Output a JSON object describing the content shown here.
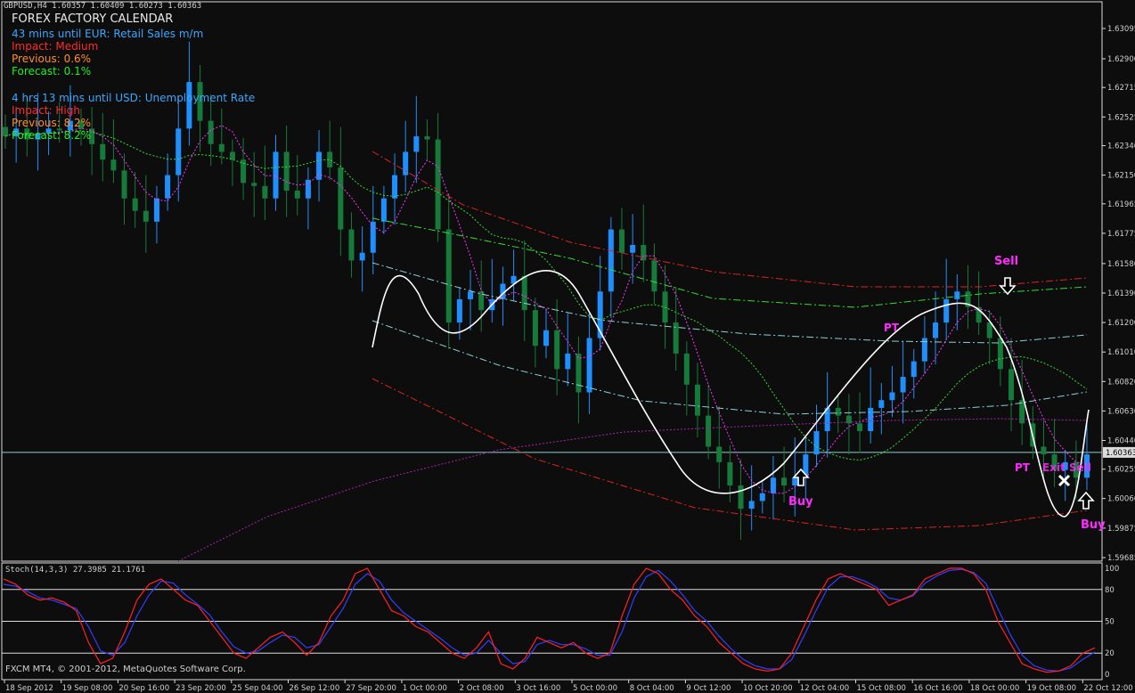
{
  "header": {
    "symbol_line": "GBPUSD,H4  1.60357 1.60409 1.60273 1.60363"
  },
  "calendar": {
    "title": "FOREX FACTORY CALENDAR",
    "event1": {
      "countdown": "43 mins until EUR: Retail Sales m/m",
      "impact": "Impact: Medium",
      "previous": "Previous: 0.6%",
      "forecast": "Forecast: 0.1%"
    },
    "event2": {
      "countdown": "4 hrs 13 mins until USD: Unemployment Rate",
      "impact": "Impact: High",
      "previous": "Previous: 8.2%",
      "forecast": "Forecast: 8.2%"
    }
  },
  "signals": {
    "sell": "Sell",
    "buy1": "Buy",
    "buy2": "Buy",
    "pt1": "PT",
    "pt2": "PT",
    "exit_sell": "Exit Sell"
  },
  "indicator": {
    "label": "Stoch(14,3,3) 27.3985 21.1761",
    "levels": [
      "100",
      "80",
      "50",
      "20",
      "0"
    ]
  },
  "footer": {
    "copyright": "FXCM MT4, © 2001-2012, MetaQuotes Software Corp."
  },
  "colors": {
    "bull": "#1e8fff",
    "bear": "#167b3a",
    "bg": "#0d0d0d",
    "grid": "#8ecfd0",
    "stoch_main": "#ff2020",
    "stoch_signal": "#2f3fff"
  },
  "chart_data": {
    "type": "candlestick",
    "symbol": "GBPUSD",
    "timeframe": "H4",
    "price_axis_ticks": [
      "1.63095",
      "1.62900",
      "1.62715",
      "1.62525",
      "1.62340",
      "1.62150",
      "1.61965",
      "1.61775",
      "1.61580",
      "1.61390",
      "1.61200",
      "1.61010",
      "1.60820",
      "1.60630",
      "1.60440",
      "1.60255",
      "1.60066",
      "1.59875",
      "1.59685"
    ],
    "current_price_label": "1.60363",
    "time_axis_labels": [
      "18 Sep 2012",
      "19 Sep 08:00",
      "20 Sep 16:00",
      "23 Sep 20:00",
      "25 Sep 04:00",
      "26 Sep 12:00",
      "27 Sep 20:00",
      "1 Oct 00:00",
      "2 Oct 08:00",
      "3 Oct 16:00",
      "5 Oct 00:00",
      "8 Oct 04:00",
      "9 Oct 12:00",
      "10 Oct 20:00",
      "12 Oct 04:00",
      "15 Oct 08:00",
      "16 Oct 16:00",
      "18 Oct 00:00",
      "19 Oct 08:00",
      "22 Oct 12:00"
    ],
    "close_path": [
      1.624,
      1.6245,
      1.6238,
      1.6242,
      1.6245,
      1.6244,
      1.625,
      1.6245,
      1.6235,
      1.6225,
      1.6218,
      1.62,
      1.6192,
      1.6185,
      1.62,
      1.6215,
      1.6245,
      1.6275,
      1.625,
      1.6235,
      1.623,
      1.6225,
      1.621,
      1.6208,
      1.62,
      1.623,
      1.6205,
      1.62,
      1.6212,
      1.623,
      1.622,
      1.618,
      1.616,
      1.6165,
      1.6185,
      1.62,
      1.6215,
      1.623,
      1.624,
      1.6238,
      1.618,
      1.612,
      1.6135,
      1.614,
      1.6128,
      1.6135,
      1.6145,
      1.615,
      1.6128,
      1.6105,
      1.6115,
      1.609,
      1.61,
      1.6075,
      1.611,
      1.614,
      1.618,
      1.6165,
      1.617,
      1.616,
      1.614,
      1.612,
      1.61,
      1.608,
      1.606,
      1.604,
      1.603,
      1.6015,
      1.6,
      1.6005,
      1.601,
      1.602,
      1.6015,
      1.602,
      1.6035,
      1.605,
      1.6065,
      1.606,
      1.6055,
      1.605,
      1.6065,
      1.607,
      1.6075,
      1.6085,
      1.6095,
      1.611,
      1.612,
      1.6135,
      1.614,
      1.613,
      1.612,
      1.611,
      1.609,
      1.607,
      1.6055,
      1.604,
      1.6035,
      1.6025,
      1.603,
      1.602,
      1.6035
    ],
    "stoch_main": [
      90,
      85,
      75,
      70,
      72,
      68,
      60,
      30,
      10,
      15,
      40,
      70,
      85,
      90,
      80,
      70,
      65,
      50,
      35,
      20,
      15,
      25,
      35,
      40,
      30,
      18,
      30,
      55,
      70,
      95,
      100,
      80,
      60,
      55,
      45,
      40,
      30,
      20,
      15,
      25,
      40,
      10,
      5,
      15,
      35,
      30,
      25,
      30,
      20,
      15,
      20,
      55,
      85,
      100,
      95,
      80,
      70,
      55,
      45,
      30,
      20,
      10,
      5,
      3,
      5,
      20,
      45,
      70,
      90,
      95,
      90,
      85,
      80,
      65,
      70,
      75,
      90,
      95,
      100,
      100,
      95,
      80,
      50,
      30,
      10,
      5,
      2,
      3,
      8,
      20,
      25
    ],
    "stoch_signal": [
      85,
      83,
      78,
      72,
      70,
      66,
      62,
      45,
      22,
      18,
      30,
      55,
      75,
      88,
      86,
      75,
      66,
      56,
      40,
      26,
      20,
      22,
      30,
      37,
      35,
      25,
      28,
      45,
      62,
      85,
      95,
      88,
      70,
      58,
      50,
      42,
      34,
      25,
      18,
      20,
      32,
      20,
      10,
      12,
      28,
      32,
      28,
      28,
      24,
      18,
      18,
      40,
      72,
      92,
      98,
      88,
      75,
      60,
      50,
      36,
      24,
      14,
      8,
      5,
      5,
      14,
      36,
      60,
      82,
      92,
      92,
      88,
      82,
      72,
      70,
      74,
      86,
      93,
      98,
      99,
      96,
      86,
      62,
      38,
      18,
      8,
      4,
      3,
      6,
      14,
      21
    ],
    "stoch_current": {
      "main": 27.3985,
      "signal": 21.1761
    },
    "annotations": [
      "Sell",
      "Buy",
      "Buy",
      "PT",
      "PT",
      "Exit Sell"
    ]
  }
}
